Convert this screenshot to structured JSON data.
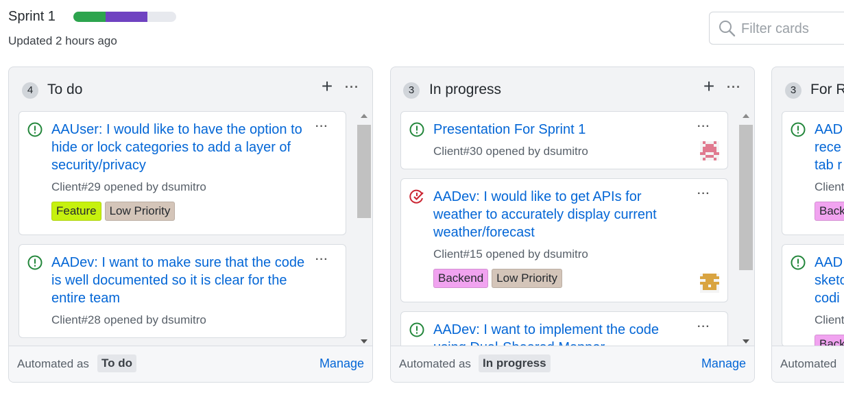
{
  "header": {
    "title": "Sprint 1",
    "updated": "Updated 2 hours ago",
    "progress": {
      "done": 0.31,
      "in_progress": 0.41,
      "colors": {
        "done": "#2da44e",
        "in_progress": "#6f42c1",
        "track": "#e7e9ee"
      }
    }
  },
  "filter": {
    "placeholder": "Filter cards",
    "icon": "search-icon"
  },
  "columns": [
    {
      "count": "4",
      "name": "To do",
      "cards": [
        {
          "title": "AAUser: I would like to have the option to hide or lock categories to add a layer of security/privacy",
          "meta": "Client#29 opened by dsumitro",
          "status": "open",
          "labels": [
            {
              "text": "Feature",
              "color": "#c6f10e"
            },
            {
              "text": "Low Priority",
              "color": "#d4c5b9"
            }
          ]
        },
        {
          "title": "AADev: I want to make sure that the code is well documented so it is clear for the entire team",
          "meta": "Client#28 opened by dsumitro",
          "status": "open",
          "labels": []
        }
      ],
      "automated_prefix": "Automated as",
      "automated_value": "To do",
      "manage": "Manage"
    },
    {
      "count": "3",
      "name": "In progress",
      "cards": [
        {
          "title": "Presentation For Sprint 1",
          "meta": "Client#30 opened by dsumitro",
          "status": "open",
          "labels": []
        },
        {
          "title": "AADev: I would like to get APIs for weather to accurately display current weather/forecast",
          "meta": "Client#15 opened by dsumitro",
          "status": "closed",
          "labels": [
            {
              "text": "Backend",
              "color": "#f1a3f0"
            },
            {
              "text": "Low Priority",
              "color": "#d4c5b9"
            }
          ]
        },
        {
          "title": "AADev: I want to implement the code using Dual-Sheared Mapper",
          "meta": "",
          "status": "open",
          "labels": []
        }
      ],
      "automated_prefix": "Automated as",
      "automated_value": "In progress",
      "manage": "Manage"
    },
    {
      "count": "3",
      "name": "For R",
      "cards": [
        {
          "title": "AAD rece tab r",
          "meta": "Client",
          "status": "open",
          "labels": [
            {
              "text": "Back",
              "color": "#f1a3f0"
            }
          ]
        },
        {
          "title": "AAD sketc codi",
          "meta": "Client",
          "status": "open",
          "labels": [
            {
              "text": "Back",
              "color": "#f1a3f0"
            }
          ]
        }
      ],
      "automated_prefix": "Automated",
      "automated_value": "",
      "manage": ""
    }
  ]
}
